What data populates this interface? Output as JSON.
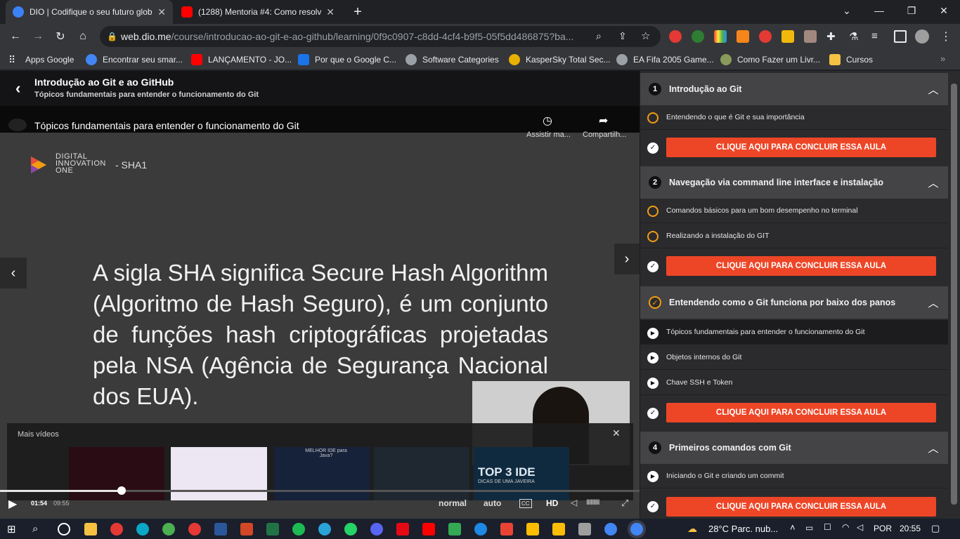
{
  "tabs": [
    {
      "title": "DIO | Codifique o seu futuro glob",
      "active": true,
      "favicon_color": "#3b82f6"
    },
    {
      "title": "(1288) Mentoria #4: Como resolv",
      "active": false,
      "favicon_color": "#ff0000"
    }
  ],
  "new_tab": "+",
  "window_controls": {
    "dropdown": "⌄",
    "minimize": "—",
    "maximize": "❐",
    "close": "✕"
  },
  "omnibox": {
    "host": "web.dio.me",
    "path": "/course/introducao-ao-git-e-ao-github/learning/0f9c0907-c8dd-4cf4-b9f5-05f5dd486875?ba..."
  },
  "nav": {
    "back": "←",
    "forward": "→",
    "reload": "↻",
    "home": "⌂"
  },
  "bookmarks": [
    {
      "label": "Apps Google",
      "color": "#8ab4f8"
    },
    {
      "label": "Encontrar seu smar...",
      "color": "#4285f4"
    },
    {
      "label": "LANÇAMENTO - JO...",
      "color": "#ff0000"
    },
    {
      "label": "Por que o Google C...",
      "color": "#1a73e8"
    },
    {
      "label": "Software Categories",
      "color": "#9aa0a6"
    },
    {
      "label": "KasperSky Total Sec...",
      "color": "#e8b000"
    },
    {
      "label": "EA Fifa 2005 Game...",
      "color": "#9aa0a6"
    },
    {
      "label": "Como Fazer um Livr...",
      "color": "#8a9a5b"
    },
    {
      "label": "Cursos",
      "color": "#f6c244"
    }
  ],
  "course": {
    "title": "Introdução ao Git e ao GitHub",
    "subtitle": "Tópicos fundamentais para entender o funcionamento do Git"
  },
  "video": {
    "title": "Tópicos fundamentais para entender o funcionamento do Git",
    "watch_later": "Assistir ma...",
    "share": "Compartilh...",
    "logo_lines": [
      "DIGITAL",
      "INNOVATION",
      "ONE"
    ],
    "slide_tag": "- SHA1",
    "slide_text": "A sigla SHA significa Secure Hash Algorithm (Algoritmo de Hash Seguro), é um conjunto de funções hash criptográficas projetadas pela NSA (Agência de Segurança Nacional dos EUA).",
    "more_videos": "Mais vídeos",
    "related_thumb_text": "TOP 3 IDE",
    "related_thumb_sub": "DICAS DE UMA JAVEIRA",
    "related_thumb2_text": "MELHOR IDE para Java?",
    "current_time": "01:54",
    "duration": "09:55",
    "progress_pct": 19,
    "quality_normal": "normal",
    "quality_auto": "auto",
    "cc": "CC",
    "hd": "HD"
  },
  "sections": [
    {
      "num": "1",
      "title": "Introdução ao Git",
      "lessons": [
        {
          "title": "Entendendo o que é Git e sua importância"
        }
      ]
    },
    {
      "num": "2",
      "title": "Navegação via command line interface e instalação",
      "lessons": [
        {
          "title": "Comandos básicos para um bom desempenho no terminal"
        },
        {
          "title": "Realizando a instalação do GIT"
        }
      ]
    },
    {
      "num": "",
      "title": "Entendendo como o Git funciona por baixo dos panos",
      "lessons": [
        {
          "title": "Tópicos fundamentais para entender o funcionamento do Git"
        },
        {
          "title": "Objetos internos do Git"
        },
        {
          "title": "Chave SSH e Token"
        }
      ]
    },
    {
      "num": "4",
      "title": "Primeiros comandos com Git",
      "lessons": [
        {
          "title": "Iniciando o Git e criando um commit"
        }
      ]
    }
  ],
  "complete_button": "CLIQUE AQUI PARA CONCLUIR ESSA AULA",
  "colors": {
    "accent": "#ed4627",
    "orange": "#f39c12"
  },
  "taskbar": {
    "weather": "28°C  Parc. nub...",
    "lang": "POR",
    "time": "20:55"
  }
}
